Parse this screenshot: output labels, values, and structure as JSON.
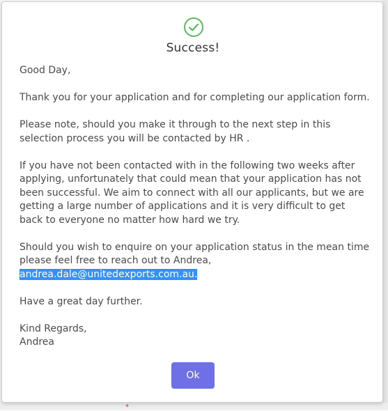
{
  "dialog": {
    "title": "Success!",
    "icon": "check-circle-icon",
    "icon_color": "#5cb85c",
    "paragraphs": {
      "greeting": "Good Day,",
      "thanks": "Thank you for your application and for completing our application form.",
      "next_step": "Please note, should you make it through to the next step in this selection process you will be contacted by HR .",
      "not_contacted": "If you have not been contacted with in the following two weeks after applying, unfortunately that could mean that your application has not been successful. We aim to connect with all our applicants, but we are getting a large number of applications and it is very difficult to get back to everyone no matter how hard we try.",
      "enquire": "Should you wish to enquire on your application status in the mean time please feel free to reach out to Andrea,",
      "email": "andrea.dale@unitedexports.com.au.",
      "closing": "Have a great day further.",
      "regards": "Kind Regards,",
      "signature": "Andrea"
    },
    "ok_label": "Ok",
    "ok_color": "#6f70e6",
    "selection_color": "#3390ff"
  }
}
